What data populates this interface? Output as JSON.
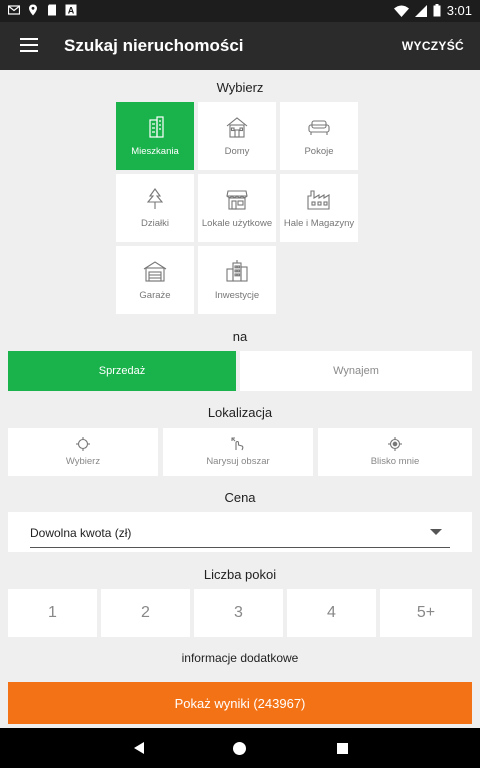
{
  "status_bar": {
    "time": "3:01",
    "left_icons": [
      "gmail-icon",
      "location-icon",
      "sd-card-icon",
      "font-icon"
    ],
    "right_icons": [
      "wifi-icon",
      "signal-icon",
      "battery-icon"
    ]
  },
  "app_bar": {
    "title": "Szukaj nieruchomości",
    "clear_label": "WYCZYŚĆ",
    "background": "#2b2b2b"
  },
  "property_type": {
    "title": "Wybierz",
    "items": [
      {
        "label": "Mieszkania",
        "icon": "apartment-building-icon",
        "selected": true
      },
      {
        "label": "Domy",
        "icon": "house-icon",
        "selected": false
      },
      {
        "label": "Pokoje",
        "icon": "sofa-icon",
        "selected": false
      },
      {
        "label": "Działki",
        "icon": "tree-icon",
        "selected": false
      },
      {
        "label": "Lokale użytkowe",
        "icon": "storefront-icon",
        "selected": false
      },
      {
        "label": "Hale i Magazyny",
        "icon": "factory-icon",
        "selected": false
      },
      {
        "label": "Garaże",
        "icon": "garage-icon",
        "selected": false
      },
      {
        "label": "Inwestycje",
        "icon": "city-buildings-icon",
        "selected": false
      }
    ]
  },
  "transaction": {
    "title": "na",
    "options": [
      {
        "label": "Sprzedaż",
        "selected": true
      },
      {
        "label": "Wynajem",
        "selected": false
      }
    ]
  },
  "location": {
    "title": "Lokalizacja",
    "options": [
      {
        "label": "Wybierz",
        "icon": "crosshair-icon"
      },
      {
        "label": "Narysuj obszar",
        "icon": "draw-hand-icon"
      },
      {
        "label": "Blisko mnie",
        "icon": "my-location-icon"
      }
    ]
  },
  "price": {
    "title": "Cena",
    "value": "Dowolna kwota (zł)"
  },
  "rooms": {
    "title": "Liczba pokoi",
    "options": [
      "1",
      "2",
      "3",
      "4",
      "5+"
    ]
  },
  "additional": {
    "title": "informacje dodatkowe"
  },
  "results_button": {
    "label": "Pokaż wyniki (243967)",
    "color": "#f47216"
  },
  "colors": {
    "accent_green": "#19b24b",
    "accent_orange": "#f47216"
  }
}
